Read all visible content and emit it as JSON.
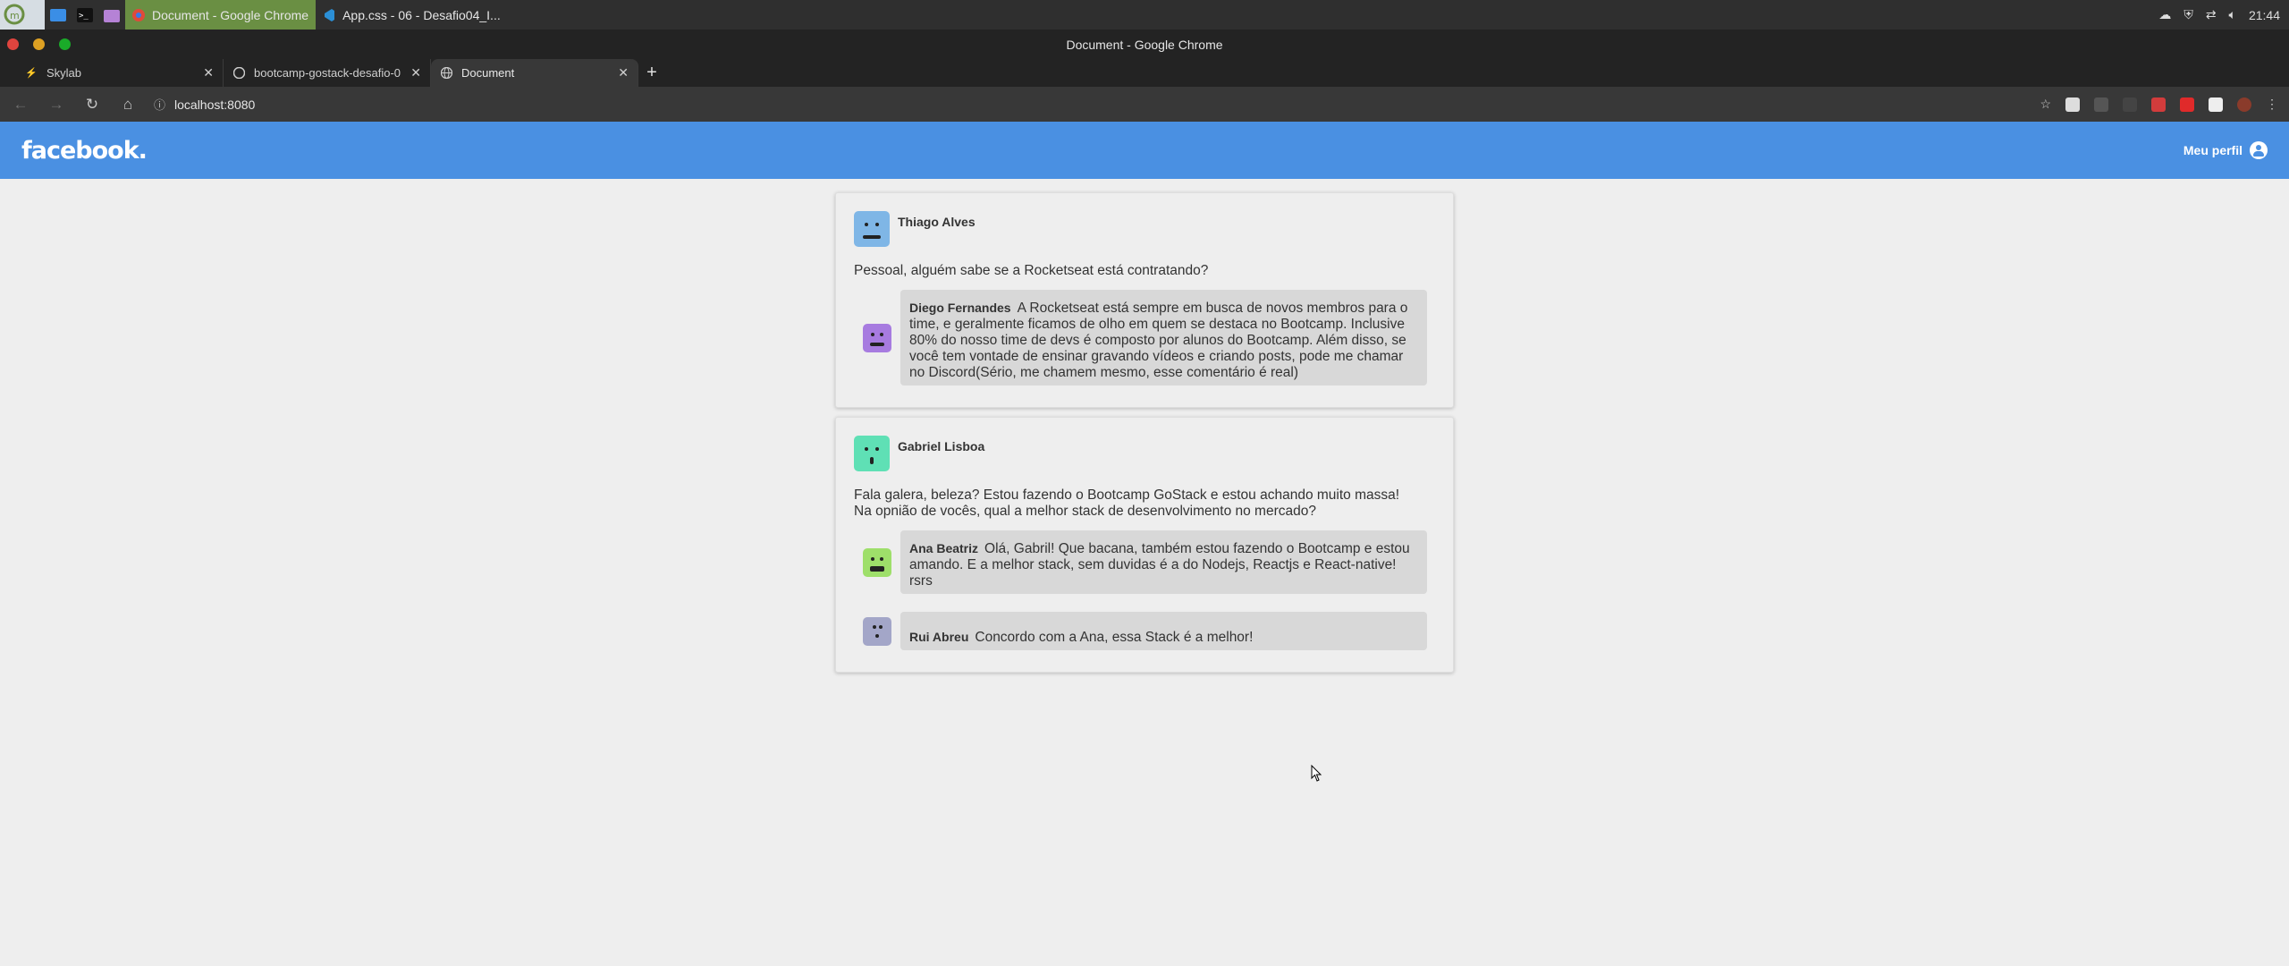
{
  "taskbar": {
    "windows": [
      {
        "label": "Document - Google Chrome",
        "active": true
      },
      {
        "label": "App.css - 06 - Desafio04_I...",
        "active": false
      }
    ],
    "clock": "21:44"
  },
  "window": {
    "title": "Document - Google Chrome"
  },
  "tabs": [
    {
      "label": "Skylab",
      "active": false
    },
    {
      "label": "bootcamp-gostack-desafio-0",
      "active": false
    },
    {
      "label": "Document",
      "active": true
    }
  ],
  "address": {
    "url": "localhost:8080"
  },
  "app": {
    "logo": "facebook.",
    "profile_label": "Meu perfil",
    "brand_color": "#4a90e2"
  },
  "posts": [
    {
      "author": "Thiago Alves",
      "avatar_color": "#7fb6e6",
      "text": "Pessoal, alguém sabe se a Rocketseat está contratando?",
      "comments": [
        {
          "author": "Diego Fernandes",
          "avatar_color": "#a77be0",
          "text": "A Rocketseat está sempre em busca de novos membros para o time, e geralmente ficamos de olho em quem se destaca no Bootcamp. Inclusive 80% do nosso time de devs é composto por alunos do Bootcamp. Além disso, se você tem vontade de ensinar gravando vídeos e criando posts, pode me chamar no Discord(Sério, me chamem mesmo, esse comentário é real)"
        }
      ]
    },
    {
      "author": "Gabriel Lisboa",
      "avatar_color": "#5fe0b5",
      "text_lines": [
        "Fala galera, beleza? Estou fazendo o Bootcamp GoStack e estou achando muito massa!",
        "Na opnião de vocês, qual a melhor stack de desenvolvimento no mercado?"
      ],
      "comments": [
        {
          "author": "Ana Beatriz",
          "avatar_color": "#9edf6a",
          "text": "Olá, Gabril! Que bacana, também estou fazendo o Bootcamp e estou amando. E a melhor stack, sem duvidas é a do Nodejs, Reactjs e React-native! rsrs"
        },
        {
          "author": "Rui Abreu",
          "avatar_color": "#a3a6c8",
          "text": "Concordo com a Ana, essa Stack é a melhor!"
        }
      ]
    }
  ]
}
